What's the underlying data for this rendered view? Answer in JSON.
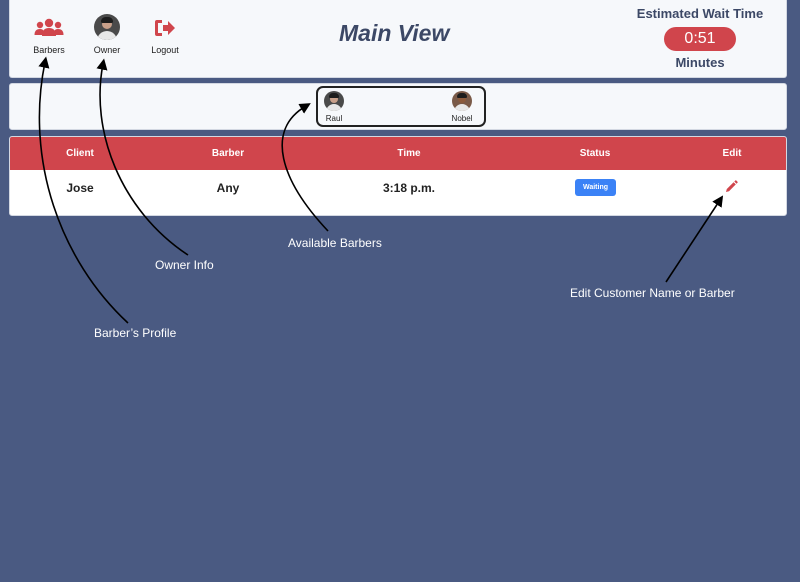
{
  "nav": {
    "barbers_label": "Barbers",
    "owner_label": "Owner",
    "logout_label": "Logout"
  },
  "page_title": "Main View",
  "wait_time": {
    "title": "Estimated Wait Time",
    "value": "0:51",
    "unit": "Minutes"
  },
  "available_barbers": [
    {
      "name": "Raul"
    },
    {
      "name": "Nobel"
    }
  ],
  "table": {
    "headers": [
      "Client",
      "Barber",
      "Time",
      "Status",
      "Edit"
    ],
    "rows": [
      {
        "client": "Jose",
        "barber": "Any",
        "time": "3:18 p.m.",
        "status": "Waiting"
      }
    ]
  },
  "annotations": {
    "barbers_profile": "Barber’s Profile",
    "owner_info": "Owner Info",
    "available_barbers": "Available Barbers",
    "edit_customer": "Edit Customer Name or Barber"
  },
  "colors": {
    "accent_red": "#d0454c",
    "status_blue": "#3b82f6",
    "background": "#4a5a82"
  },
  "icons": {
    "barbers": "users-icon",
    "owner": "owner-avatar",
    "logout": "sign-out-icon",
    "edit": "pencil-icon"
  }
}
